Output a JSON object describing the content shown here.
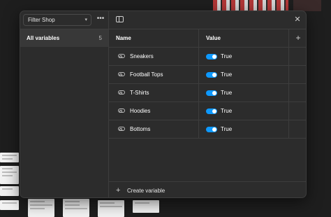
{
  "sidebar": {
    "collection_name": "Filter Shop",
    "groups": [
      {
        "label": "All variables",
        "count": "5"
      }
    ]
  },
  "table": {
    "headers": {
      "name": "Name",
      "value": "Value"
    },
    "rows": [
      {
        "name": "Sneakers",
        "value": "True"
      },
      {
        "name": "Football Tops",
        "value": "True"
      },
      {
        "name": "T-Shirts",
        "value": "True"
      },
      {
        "name": "Hoodies",
        "value": "True"
      },
      {
        "name": "Bottoms",
        "value": "True"
      }
    ]
  },
  "footer": {
    "create_label": "Create variable"
  },
  "icons": {
    "more": "more-horizontal-icon",
    "sidebar_toggle": "sidebar-toggle-icon",
    "close": "close-icon",
    "add_column": "plus-icon",
    "variable_type": "boolean-toggle-icon",
    "chevron": "chevron-down-icon"
  },
  "colors": {
    "panel_bg": "#2c2c2c",
    "toggle_on": "#0d99ff",
    "selected_row": "#383838"
  }
}
